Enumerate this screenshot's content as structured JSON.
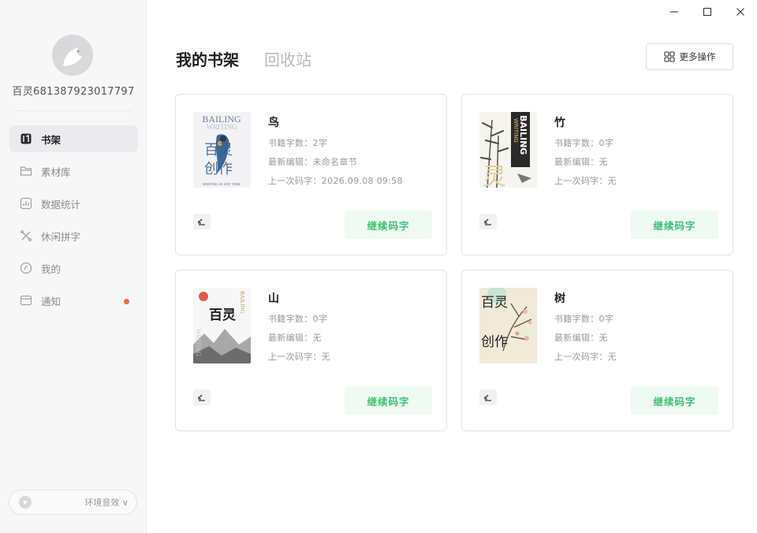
{
  "window": {
    "controls": [
      "minimize-icon",
      "maximize-icon",
      "close-icon"
    ]
  },
  "sidebar": {
    "username": "百灵681387923017797",
    "items": [
      {
        "label": "书架",
        "icon": "book-icon",
        "active": true
      },
      {
        "label": "素材库",
        "icon": "folder-icon",
        "active": false
      },
      {
        "label": "数据统计",
        "icon": "chart-icon",
        "active": false
      },
      {
        "label": "休闲拼字",
        "icon": "puzzle-icon",
        "active": false
      },
      {
        "label": "我的",
        "icon": "compass-icon",
        "active": false
      },
      {
        "label": "通知",
        "icon": "mail-icon",
        "active": false,
        "badge": "red-dot"
      }
    ],
    "sound": {
      "label": "环境音效 ∨",
      "icon": "play-icon"
    }
  },
  "header": {
    "tabs": [
      {
        "label": "我的书架",
        "active": true
      },
      {
        "label": "回收站",
        "active": false
      }
    ],
    "more_label": "更多操作"
  },
  "books": [
    {
      "title": "鸟",
      "cover_text": [
        "BAILING",
        "WRITING",
        "百灵",
        "创作",
        "WRITING AT ANY TIME"
      ],
      "word_count": "书籍字数：2字",
      "last_edit": "最新编辑：未命名章节",
      "last_time": "上一次码字：2026.09.08 09:58",
      "continue_label": "继续码字"
    },
    {
      "title": "竹",
      "cover_text": [
        "BAILING",
        "WRITING",
        "灵"
      ],
      "word_count": "书籍字数：0字",
      "last_edit": "最新编辑：无",
      "last_time": "上一次码字：无",
      "continue_label": "继续码字"
    },
    {
      "title": "山",
      "cover_text": [
        "百灵",
        "BAILING",
        "WRITING"
      ],
      "word_count": "书籍字数：0字",
      "last_edit": "最新编辑：无",
      "last_time": "上一次码字：无",
      "continue_label": "继续码字"
    },
    {
      "title": "树",
      "cover_text": [
        "百灵",
        "创作"
      ],
      "word_count": "书籍字数：0字",
      "last_edit": "最新编辑：无",
      "last_time": "上一次码字：无",
      "continue_label": "继续码字"
    }
  ],
  "colors": {
    "accent_green": "#3fbf75",
    "accent_green_bg": "#eefaf2",
    "notify_red": "#f26b4b",
    "sidebar_bg": "#f7f7f8"
  }
}
